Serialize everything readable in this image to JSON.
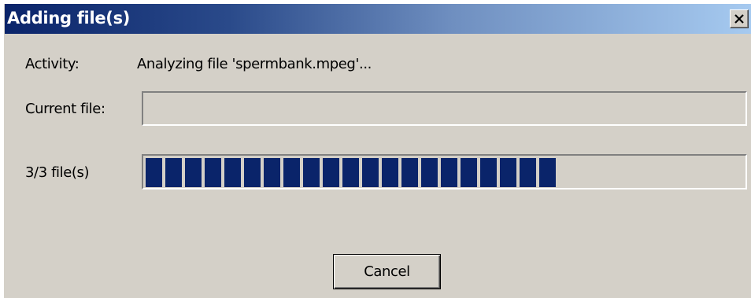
{
  "window": {
    "title": "Adding file(s)",
    "close_icon": "close-icon"
  },
  "activity": {
    "label": "Activity:",
    "value": "Analyzing file 'spermbank.mpeg'..."
  },
  "current_file": {
    "label": "Current file:",
    "value": ""
  },
  "progress": {
    "label": "3/3 file(s)",
    "fraction": 0.69,
    "color": "#0a246a"
  },
  "buttons": {
    "cancel_label": "Cancel"
  }
}
